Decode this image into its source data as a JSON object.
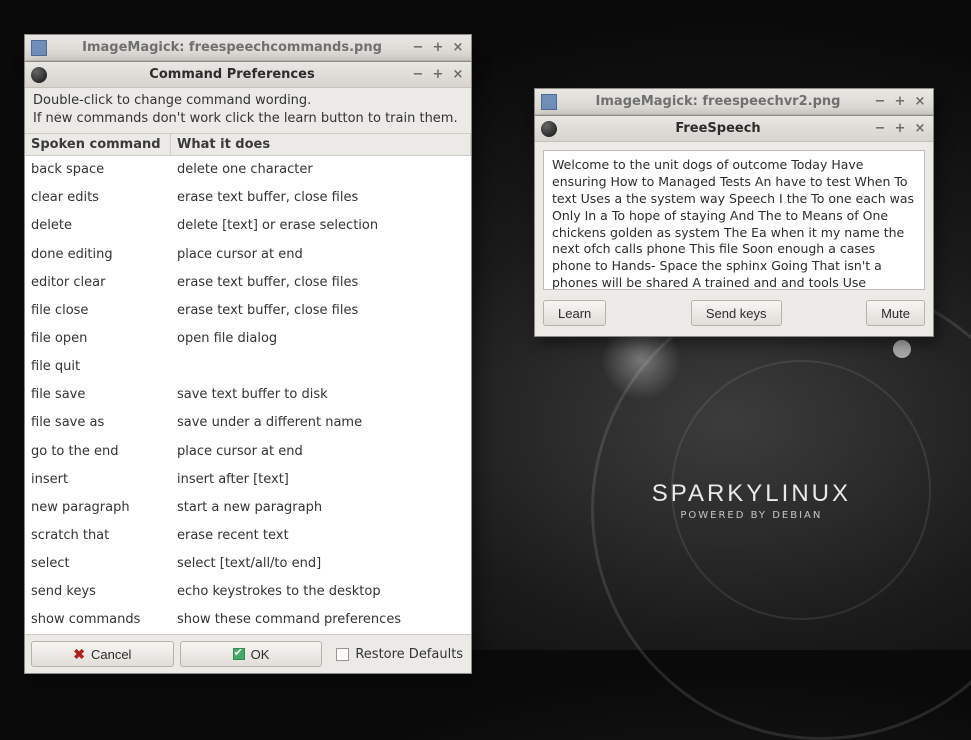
{
  "desktop": {
    "branding_main": "SPARKYLINUX",
    "branding_sub": "POWERED BY DEBIAN"
  },
  "im1": {
    "title": "ImageMagick: freespeechcommands.png"
  },
  "im2": {
    "title": "ImageMagick: freespeechvr2.png"
  },
  "prefs": {
    "title": "Command Preferences",
    "instr1": "Double-click to change command wording.",
    "instr2": "If new commands don't work click the learn button to train them.",
    "col1": "Spoken command",
    "col2": "What it does",
    "rows": [
      {
        "cmd": "back space",
        "desc": "delete one character"
      },
      {
        "cmd": "clear edits",
        "desc": "erase text buffer, close files"
      },
      {
        "cmd": "delete",
        "desc": "delete [text] or erase selection"
      },
      {
        "cmd": "done editing",
        "desc": "place cursor at end"
      },
      {
        "cmd": "editor clear",
        "desc": "erase text buffer, close files"
      },
      {
        "cmd": "file close",
        "desc": "erase text buffer, close files"
      },
      {
        "cmd": "file open",
        "desc": "open file dialog"
      },
      {
        "cmd": "file quit",
        "desc": ""
      },
      {
        "cmd": "file save",
        "desc": "save text buffer to disk"
      },
      {
        "cmd": "file save as",
        "desc": "save under a different name"
      },
      {
        "cmd": "go to the end",
        "desc": "place cursor at end"
      },
      {
        "cmd": "insert",
        "desc": "insert after [text]"
      },
      {
        "cmd": "new paragraph",
        "desc": "start a new paragraph"
      },
      {
        "cmd": "scratch that",
        "desc": "erase recent text"
      },
      {
        "cmd": "select",
        "desc": "select [text/all/to end]"
      },
      {
        "cmd": "send keys",
        "desc": "echo keystrokes to the desktop"
      },
      {
        "cmd": "show commands",
        "desc": "show these command preferences"
      }
    ],
    "cancel": "Cancel",
    "ok": "OK",
    "restore": "Restore Defaults"
  },
  "fs": {
    "title": "FreeSpeech",
    "text": "Welcome to the unit dogs of outcome Today Have ensuring How to Managed Tests An have to test When To text Uses a the system way Speech I the To one each was Only In a To hope of staying And The to Means of One chickens golden as system The Ea when it my name the next ofch calls phone This file Soon enough a cases phone to Hands- Space the sphinx Going That isn't a phones will be shared A trained and and tools Use speaking When you finished Say A used file Last a story A And using a by the When it is very how success This",
    "learn": "Learn",
    "send": "Send keys",
    "mute": "Mute"
  },
  "winctrl": {
    "min": "−",
    "max": "+",
    "close": "×"
  }
}
